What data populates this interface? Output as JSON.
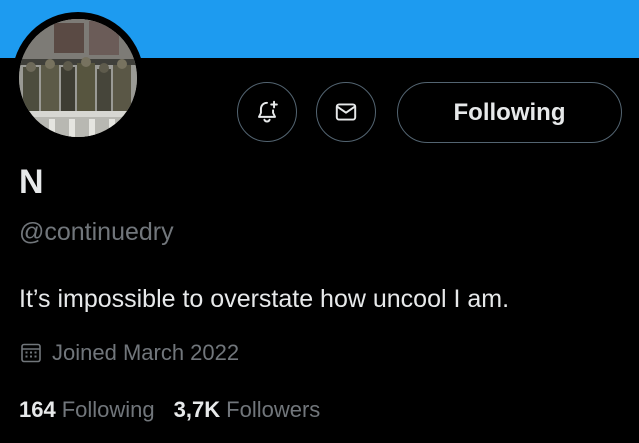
{
  "colors": {
    "banner": "#1d9bf0",
    "background": "#000000",
    "text_primary": "#e7e9ea",
    "text_secondary": "#71767b",
    "button_border": "#536471"
  },
  "header": {
    "banner_color": "#1d9bf0"
  },
  "actions": {
    "notify_icon": "bell-plus-icon",
    "message_icon": "envelope-icon",
    "follow_label": "Following"
  },
  "profile": {
    "display_name": "N",
    "handle": "@continuedry",
    "bio": "It’s impossible to overstate how uncool I am.",
    "joined_icon": "calendar-icon",
    "joined": "Joined March 2022"
  },
  "stats": {
    "following_count": "164",
    "following_label": "Following",
    "followers_count": "3,7K",
    "followers_label": "Followers"
  }
}
